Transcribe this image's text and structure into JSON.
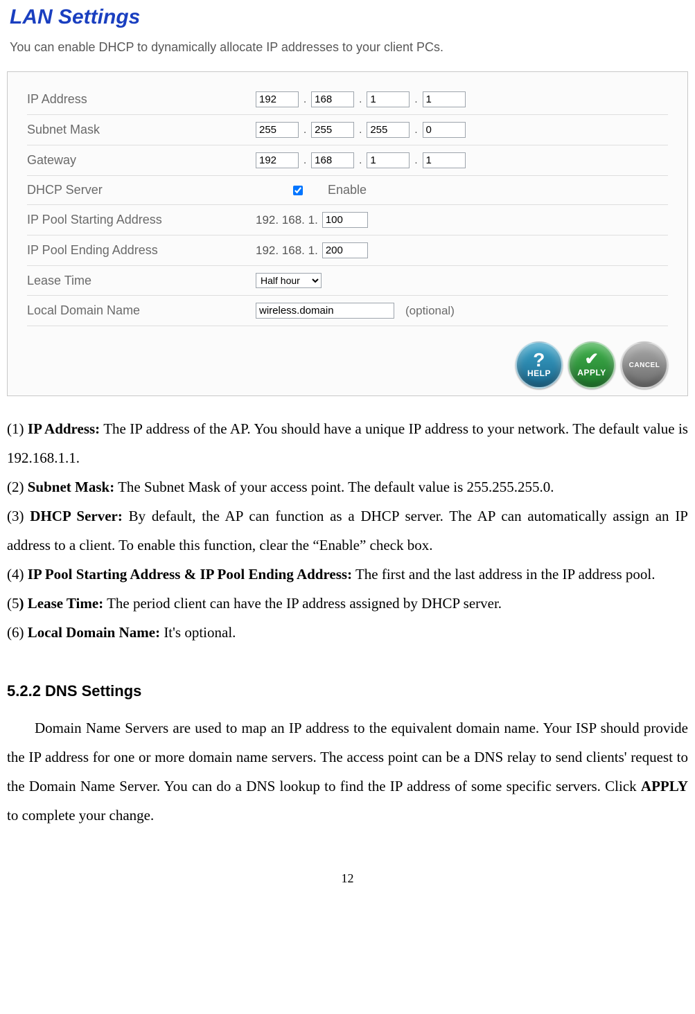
{
  "panel": {
    "title": "LAN Settings",
    "description": "You can enable DHCP to dynamically allocate IP addresses to your client PCs."
  },
  "rows": {
    "ip_address": {
      "label": "IP Address",
      "octets": [
        "192",
        "168",
        "1",
        "1"
      ]
    },
    "subnet_mask": {
      "label": "Subnet Mask",
      "octets": [
        "255",
        "255",
        "255",
        "0"
      ]
    },
    "gateway": {
      "label": "Gateway",
      "octets": [
        "192",
        "168",
        "1",
        "1"
      ]
    },
    "dhcp_server": {
      "label": "DHCP Server",
      "enable_text": "Enable",
      "checked": true
    },
    "pool_start": {
      "label": "IP Pool Starting Address",
      "prefix": "192. 168. 1.",
      "value": "100"
    },
    "pool_end": {
      "label": "IP Pool Ending Address",
      "prefix": "192. 168. 1.",
      "value": "200"
    },
    "lease_time": {
      "label": "Lease Time",
      "value": "Half hour"
    },
    "local_domain": {
      "label": "Local Domain Name",
      "value": "wireless.domain",
      "suffix": "(optional)"
    }
  },
  "buttons": {
    "help": "HELP",
    "apply": "APPLY",
    "cancel": "CANCEL"
  },
  "doc": {
    "p1a": "(1) ",
    "p1b": "IP Address:",
    "p1c": " The IP address of the AP. You should have a unique IP address to  your    network. The default value is 192.168.1.1.",
    "p2a": "(2) ",
    "p2b": "Subnet Mask:",
    "p2c": " The Subnet Mask of your access point. The default value is 255.255.255.0.",
    "p3a": "(3) ",
    "p3b": "DHCP Server:",
    "p3c": " By default, the AP can function as a DHCP server. The AP can automatically assign an IP address to a client. To enable this function, clear the “Enable” check box.",
    "p4a": "(4) ",
    "p4b": "IP Pool Starting Address & IP Pool Ending Address:",
    "p4c": " The first and the last address in the IP address pool.",
    "p5a": "(5",
    "p5b": ") Lease Time:",
    "p5c": " The period client can have the IP address assigned by DHCP server.",
    "p6a": "(6) ",
    "p6b": "Local Domain Name:",
    "p6c": " It's optional.",
    "section": "5.2.2    DNS Settings",
    "dns1": "Domain Name Servers are used to map an IP address to the equivalent domain name. Your ISP should provide the IP address for one or more domain name servers. The access point can be a DNS relay to send clients' request to the Domain Name Server. You can do a DNS lookup to find the IP address of some specific servers. Click ",
    "dns1b": "APPLY",
    "dns1c": " to complete your change."
  },
  "page_number": "12"
}
